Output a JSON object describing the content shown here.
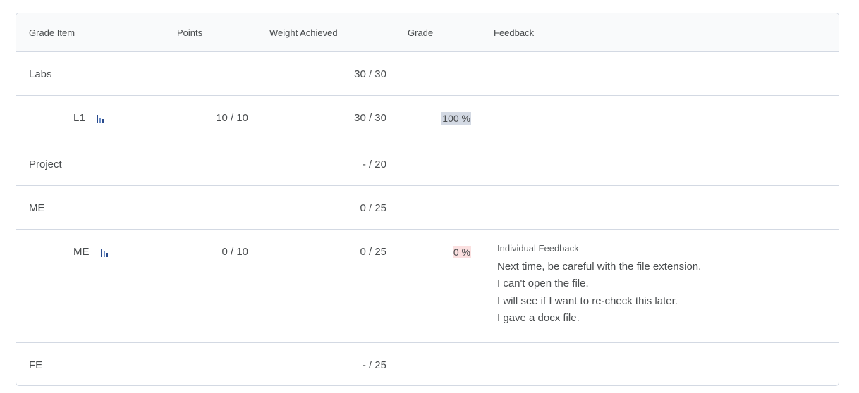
{
  "columns": {
    "grade_item": "Grade Item",
    "points": "Points",
    "weight_achieved": "Weight Achieved",
    "grade": "Grade",
    "feedback": "Feedback"
  },
  "rows": [
    {
      "item": "Labs",
      "points": "",
      "weight": "30 / 30",
      "grade": ""
    },
    {
      "item": "L1",
      "points": "10 / 10",
      "weight": "30 / 30",
      "grade": "100 %",
      "icon": "bar-chart-icon"
    },
    {
      "item": "Project",
      "points": "",
      "weight": "- / 20",
      "grade": ""
    },
    {
      "item": "ME",
      "points": "",
      "weight": "0 / 25",
      "grade": ""
    },
    {
      "item": "ME",
      "points": "0 / 10",
      "weight": "0 / 25",
      "grade": "0 %",
      "icon": "bar-chart-icon",
      "feedback_title": "Individual Feedback",
      "feedback_lines": [
        "Next time, be careful with the file extension.",
        "I can't open the file.",
        "I will see if I want to re-check this later.",
        "I gave a docx file."
      ]
    },
    {
      "item": "FE",
      "points": "",
      "weight": "- / 25",
      "grade": ""
    }
  ],
  "colors": {
    "border": "#d3d9e3",
    "header_bg": "#f9fafb",
    "grade_high_bg": "#d3d9e3",
    "grade_low_bg": "#fbe0e0",
    "icon_blue": "#2a4b8d"
  }
}
